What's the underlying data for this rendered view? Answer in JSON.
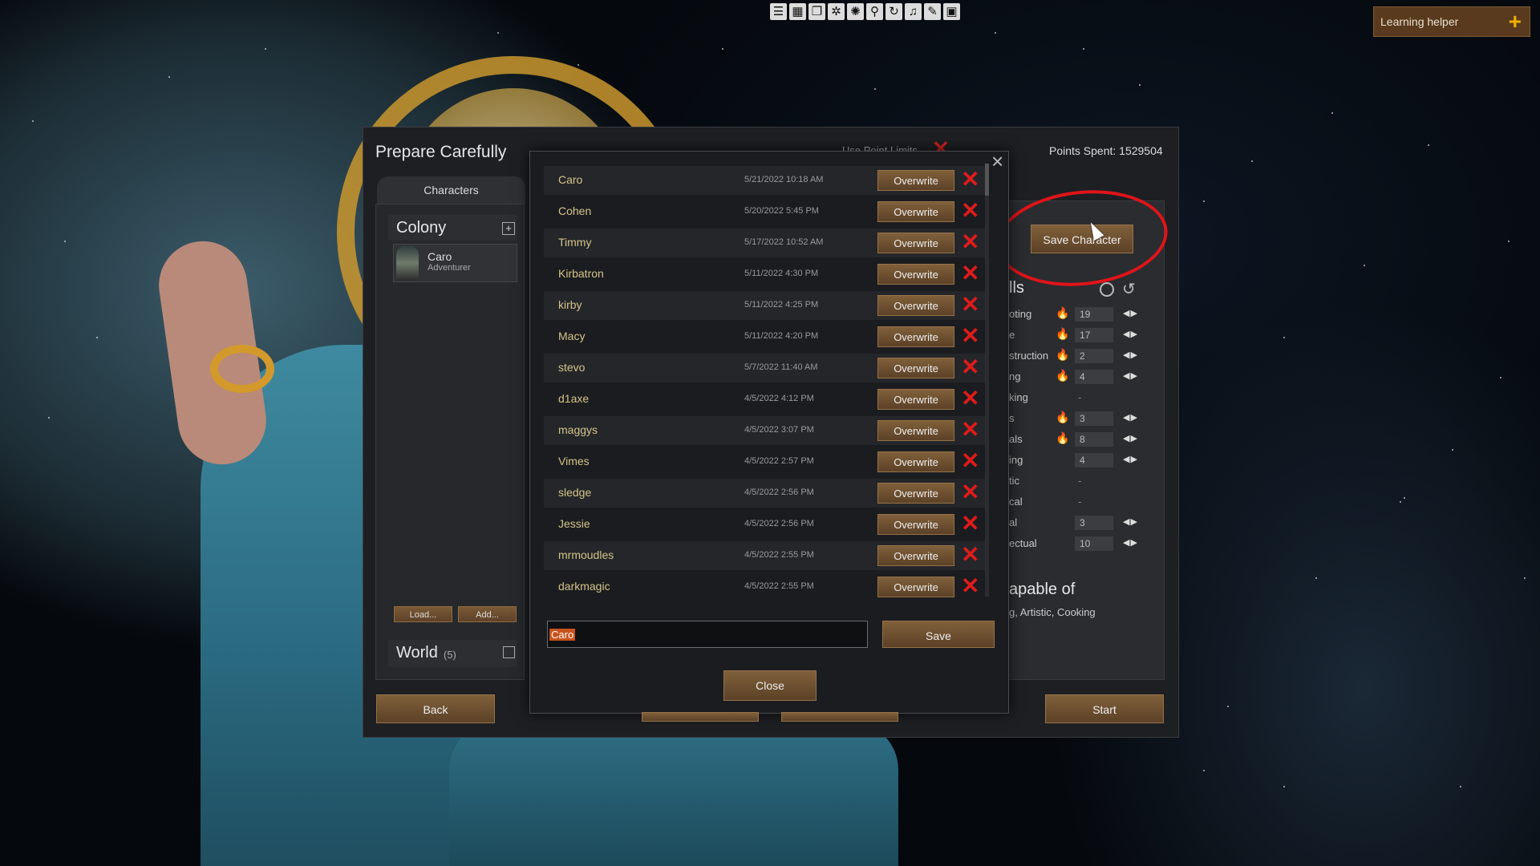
{
  "toolbar": {
    "icons": [
      "list-icon",
      "grid-icon",
      "copy-icon",
      "gear-icon",
      "sun-icon",
      "search-icon",
      "refresh-icon",
      "music-icon",
      "paint-icon",
      "image-icon"
    ]
  },
  "learning_helper": {
    "label": "Learning helper",
    "plus": "+"
  },
  "window": {
    "title": "Prepare Carefully",
    "use_point_limits": "Use Point Limits",
    "points_spent": "Points Spent: 1529504"
  },
  "left_panel": {
    "tab": "Characters",
    "colony_label": "Colony",
    "pawn": {
      "name": "Caro",
      "role": "Adventurer"
    },
    "load_label": "Load...",
    "add_label": "Add...",
    "world_label": "World",
    "world_count": "(5)"
  },
  "buttons": {
    "back": "Back",
    "start": "Start",
    "save_character": "Save Character"
  },
  "skills": {
    "title": "lls",
    "rows": [
      {
        "label": "oting",
        "level": "19",
        "passion": 2
      },
      {
        "label": "e",
        "level": "17",
        "passion": 2
      },
      {
        "label": "struction",
        "level": "2",
        "passion": 2
      },
      {
        "label": "ng",
        "level": "4",
        "passion": 2
      },
      {
        "label": "king",
        "level": "-",
        "passion": 0
      },
      {
        "label": "s",
        "level": "3",
        "passion": 2
      },
      {
        "label": "als",
        "level": "8",
        "passion": 2
      },
      {
        "label": "ing",
        "level": "4",
        "passion": 0
      },
      {
        "label": "tic",
        "level": "-",
        "passion": 0
      },
      {
        "label": "cal",
        "level": "-",
        "passion": 0
      },
      {
        "label": "al",
        "level": "3",
        "passion": 0
      },
      {
        "label": "ectual",
        "level": "10",
        "passion": 0
      }
    ],
    "incapable_title": "apable of",
    "incapable_list": "g, Artistic, Cooking"
  },
  "dialog": {
    "close_icon": "×",
    "overwrite_label": "Overwrite",
    "entries": [
      {
        "name": "Caro",
        "date": "5/21/2022 10:18 AM"
      },
      {
        "name": "Cohen",
        "date": "5/20/2022 5:45 PM"
      },
      {
        "name": "Timmy",
        "date": "5/17/2022 10:52 AM"
      },
      {
        "name": "Kirbatron",
        "date": "5/11/2022 4:30 PM"
      },
      {
        "name": "kirby",
        "date": "5/11/2022 4:25 PM"
      },
      {
        "name": "Macy",
        "date": "5/11/2022 4:20 PM"
      },
      {
        "name": "stevo",
        "date": "5/7/2022 11:40 AM"
      },
      {
        "name": "d1axe",
        "date": "4/5/2022 4:12 PM"
      },
      {
        "name": "maggys",
        "date": "4/5/2022 3:07 PM"
      },
      {
        "name": "Vimes",
        "date": "4/5/2022 2:57 PM"
      },
      {
        "name": "sledge",
        "date": "4/5/2022 2:56 PM"
      },
      {
        "name": "Jessie",
        "date": "4/5/2022 2:56 PM"
      },
      {
        "name": "mrmoudles",
        "date": "4/5/2022 2:55 PM"
      },
      {
        "name": "darkmagic",
        "date": "4/5/2022 2:55 PM"
      }
    ],
    "filename_value": "Caro",
    "save_label": "Save",
    "close_label": "Close"
  },
  "colors": {
    "accent_red": "#e01b1b",
    "button_brown": "#6e5030",
    "passion_flame": "#f2a21a"
  }
}
